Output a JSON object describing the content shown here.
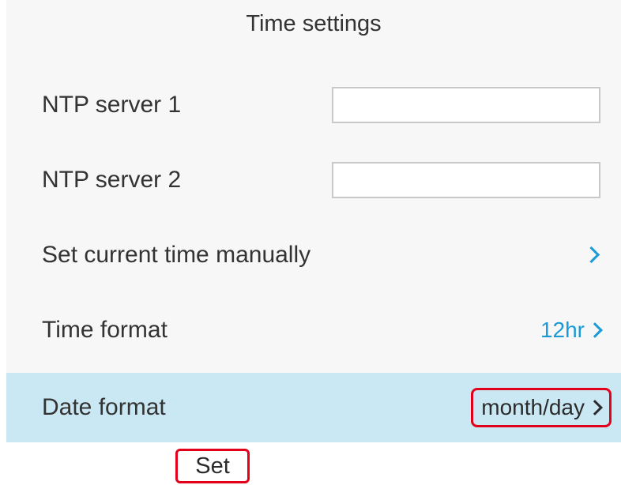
{
  "header": {
    "title": "Time settings"
  },
  "settings": {
    "ntp_server_1": {
      "label": "NTP server 1",
      "value": ""
    },
    "ntp_server_2": {
      "label": "NTP server 2",
      "value": ""
    },
    "set_time_manually": {
      "label": "Set current time manually",
      "icon": "chevron-right-icon"
    },
    "time_format": {
      "label": "Time format",
      "value": "12hr",
      "icon": "chevron-right-icon"
    },
    "date_format": {
      "label": "Date format",
      "value": "month/day",
      "icon": "chevron-right-icon",
      "selected": true
    }
  },
  "softkeys": {
    "set_label": "Set"
  },
  "colors": {
    "accent": "#1a9ad6",
    "selected_row": "#c9e8f4",
    "highlight_outline": "#e2001a"
  }
}
